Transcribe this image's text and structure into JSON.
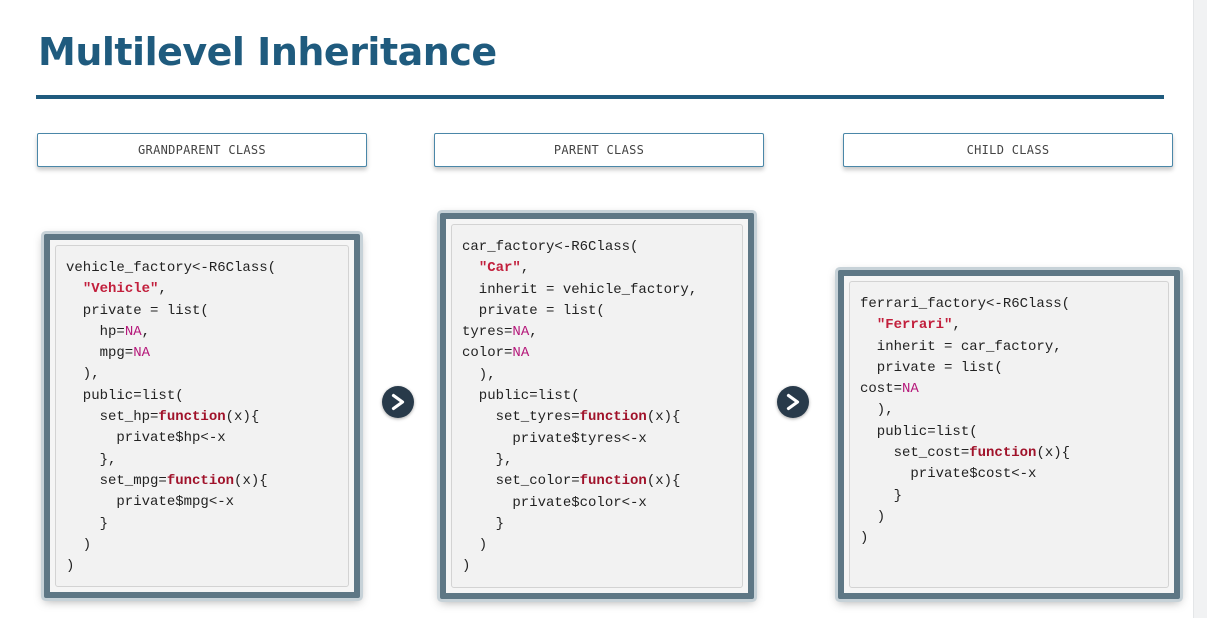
{
  "slide": {
    "title": "Multilevel Inheritance"
  },
  "columns": [
    {
      "label": "GRANDPARENT CLASS",
      "code": [
        [
          {
            "t": "vehicle_factory<-R6Class("
          }
        ],
        [
          {
            "t": "  "
          },
          {
            "t": "\"Vehicle\"",
            "c": "str"
          },
          {
            "t": ","
          }
        ],
        [
          {
            "t": "  private = list("
          }
        ],
        [
          {
            "t": "    hp="
          },
          {
            "t": "NA",
            "c": "na"
          },
          {
            "t": ","
          }
        ],
        [
          {
            "t": "    mpg="
          },
          {
            "t": "NA",
            "c": "na"
          }
        ],
        [
          {
            "t": "  ),"
          }
        ],
        [
          {
            "t": "  public=list("
          }
        ],
        [
          {
            "t": "    set_hp="
          },
          {
            "t": "function",
            "c": "kw"
          },
          {
            "t": "(x){"
          }
        ],
        [
          {
            "t": "      private$hp<-x"
          }
        ],
        [
          {
            "t": "    },"
          }
        ],
        [
          {
            "t": "    set_mpg="
          },
          {
            "t": "function",
            "c": "kw"
          },
          {
            "t": "(x){"
          }
        ],
        [
          {
            "t": "      private$mpg<-x"
          }
        ],
        [
          {
            "t": "    }"
          }
        ],
        [
          {
            "t": "  )"
          }
        ],
        [
          {
            "t": ")"
          }
        ]
      ]
    },
    {
      "label": "PARENT CLASS",
      "code": [
        [
          {
            "t": "car_factory<-R6Class("
          }
        ],
        [
          {
            "t": "  "
          },
          {
            "t": "\"Car\"",
            "c": "str"
          },
          {
            "t": ","
          }
        ],
        [
          {
            "t": "  inherit = vehicle_factory,"
          }
        ],
        [
          {
            "t": "  private = list("
          }
        ],
        [
          {
            "t": "tyres="
          },
          {
            "t": "NA",
            "c": "na"
          },
          {
            "t": ","
          }
        ],
        [
          {
            "t": "color="
          },
          {
            "t": "NA",
            "c": "na"
          }
        ],
        [
          {
            "t": "  ),"
          }
        ],
        [
          {
            "t": "  public=list("
          }
        ],
        [
          {
            "t": "    set_tyres="
          },
          {
            "t": "function",
            "c": "kw"
          },
          {
            "t": "(x){"
          }
        ],
        [
          {
            "t": "      private$tyres<-x"
          }
        ],
        [
          {
            "t": "    },"
          }
        ],
        [
          {
            "t": "    set_color="
          },
          {
            "t": "function",
            "c": "kw"
          },
          {
            "t": "(x){"
          }
        ],
        [
          {
            "t": "      private$color<-x"
          }
        ],
        [
          {
            "t": "    }"
          }
        ],
        [
          {
            "t": "  )"
          }
        ],
        [
          {
            "t": ")"
          }
        ]
      ]
    },
    {
      "label": "CHILD CLASS",
      "code": [
        [
          {
            "t": "ferrari_factory<-R6Class("
          }
        ],
        [
          {
            "t": "  "
          },
          {
            "t": "\"Ferrari\"",
            "c": "str"
          },
          {
            "t": ","
          }
        ],
        [
          {
            "t": "  inherit = car_factory,"
          }
        ],
        [
          {
            "t": "  private = list("
          }
        ],
        [
          {
            "t": "cost="
          },
          {
            "t": "NA",
            "c": "na"
          }
        ],
        [
          {
            "t": "  ),"
          }
        ],
        [
          {
            "t": "  public=list("
          }
        ],
        [
          {
            "t": "    set_cost="
          },
          {
            "t": "function",
            "c": "kw"
          },
          {
            "t": "(x){"
          }
        ],
        [
          {
            "t": "      private$cost<-x"
          }
        ],
        [
          {
            "t": "    }"
          }
        ],
        [
          {
            "t": "  )"
          }
        ],
        [
          {
            "t": ")"
          }
        ]
      ]
    }
  ],
  "icons": {
    "arrow": "chevron-right-circle-icon"
  },
  "colors": {
    "title": "#1f5b7e",
    "string": "#c21f3c",
    "keyword": "#a0122a",
    "na": "#b5187a"
  }
}
